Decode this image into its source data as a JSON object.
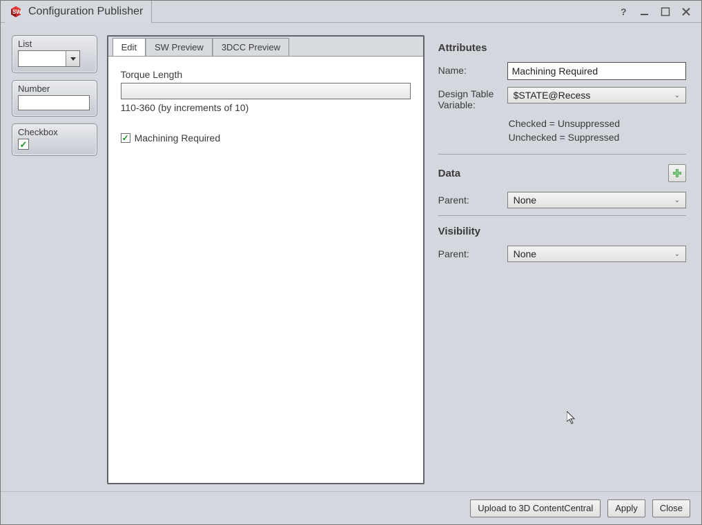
{
  "window": {
    "title": "Configuration Publisher"
  },
  "palette": {
    "list": {
      "label": "List"
    },
    "number": {
      "label": "Number"
    },
    "checkbox": {
      "label": "Checkbox"
    }
  },
  "tabs": [
    {
      "label": "Edit"
    },
    {
      "label": "SW Preview"
    },
    {
      "label": "3DCC Preview"
    }
  ],
  "canvas": {
    "torque_label": "Torque Length",
    "torque_hint": "110-360 (by increments of 10)",
    "machining_label": "Machining Required"
  },
  "attributes": {
    "heading": "Attributes",
    "name_label": "Name:",
    "name_value": "Machining Required",
    "dtv_label": "Design Table Variable:",
    "dtv_value": "$STATE@Recess",
    "hint_line1": "Checked = Unsuppressed",
    "hint_line2": "Unchecked = Suppressed"
  },
  "data_section": {
    "heading": "Data",
    "parent_label": "Parent:",
    "parent_value": "None"
  },
  "visibility": {
    "heading": "Visibility",
    "parent_label": "Parent:",
    "parent_value": "None"
  },
  "buttons": {
    "upload": "Upload to 3D ContentCentral",
    "apply": "Apply",
    "close": "Close"
  }
}
